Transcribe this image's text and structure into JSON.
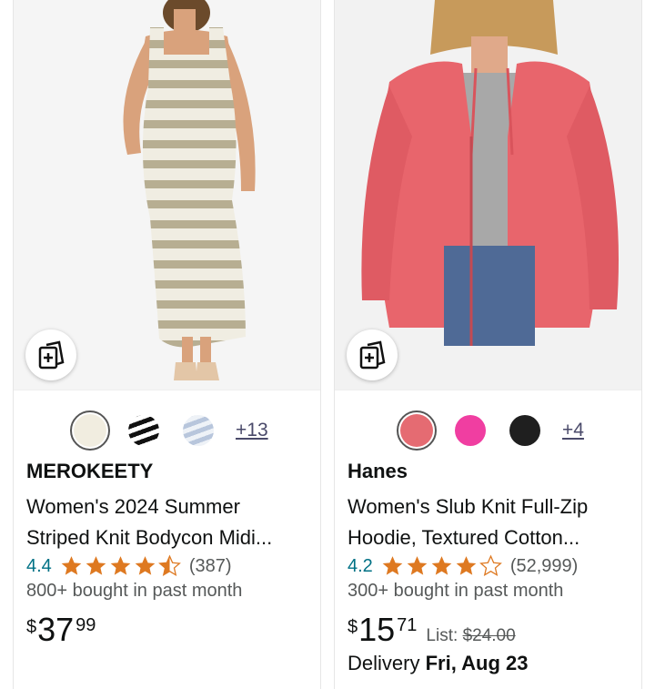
{
  "products": [
    {
      "brand": "MEROKEETY",
      "title_line1": "Women's 2024 Summer",
      "title_line2": "Striped Knit Bodycon Midi...",
      "rating": "4.4",
      "stars": 4.5,
      "review_count": "(387)",
      "bought": "800+ bought in past month",
      "price_currency": "$",
      "price_whole": "37",
      "price_fraction": "99",
      "more_colors": "+13",
      "swatch_colors": [
        "#f1ede0",
        "#222222",
        "#c9d3e4"
      ],
      "swatch_icon": "view-similar-icon"
    },
    {
      "brand": "Hanes",
      "title_line1": "Women's Slub Knit Full-Zip",
      "title_line2": "Hoodie, Textured Cotton...",
      "rating": "4.2",
      "stars": 4,
      "review_count": "(52,999)",
      "bought": "300+ bought in past month",
      "price_currency": "$",
      "price_whole": "15",
      "price_fraction": "71",
      "list_label": "List:",
      "list_price": "$24.00",
      "delivery_label": "Delivery",
      "delivery_date": "Fri, Aug 23",
      "more_colors": "+4",
      "swatch_colors": [
        "#e56b72",
        "#f03ea1",
        "#1f1f1f"
      ],
      "swatch_icon": "view-similar-icon"
    }
  ],
  "colors": {
    "rating_link": "#007185",
    "star": "#de7921",
    "secondary_text": "#565959"
  }
}
